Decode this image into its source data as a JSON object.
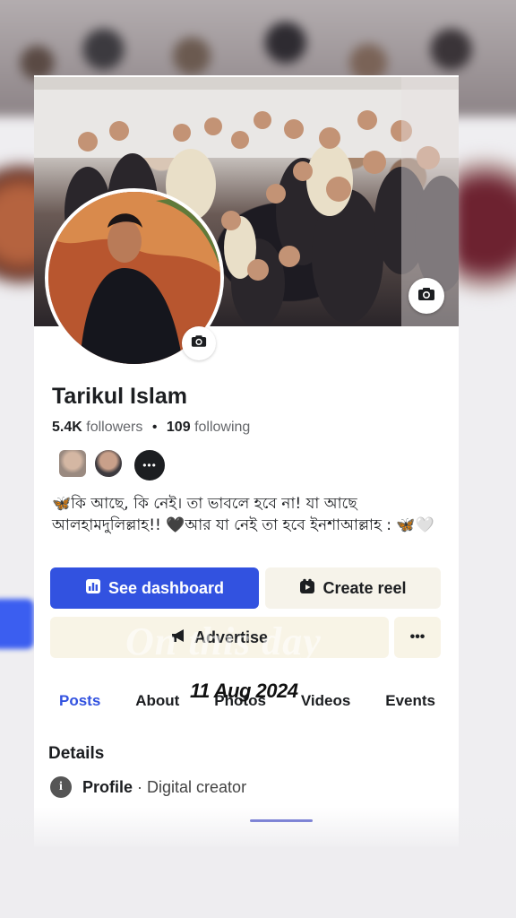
{
  "profile": {
    "name": "Tarikul Islam",
    "followers_count": "5.4K",
    "followers_label": "followers",
    "separator": "•",
    "following_count": "109",
    "following_label": "following",
    "more_friends_glyph": "•••",
    "bio": "🦋কি আছে, কি নেই। তা ভাবলে হবে না! যা আছে আলহামদুলিল্লাহ!! 🖤আর যা নেই তা হবে ইনশাআল্লাহ : 🦋🤍"
  },
  "actions": {
    "dashboard_label": "See dashboard",
    "reel_label": "Create reel",
    "advertise_label": "Advertise",
    "more_label": "•••"
  },
  "overlay": {
    "watermark": "On this day",
    "date": "11 Aug 2024"
  },
  "tabs": [
    {
      "label": "Posts",
      "active": true
    },
    {
      "label": "About"
    },
    {
      "label": "Photos"
    },
    {
      "label": "Videos"
    },
    {
      "label": "Events"
    }
  ],
  "details": {
    "title": "Details",
    "profile_label": "Profile",
    "profile_sep": " · ",
    "profile_value": "Digital creator"
  },
  "icons": {
    "cover_camera": "camera-icon",
    "avatar_camera": "camera-icon",
    "dashboard": "bar-chart-icon",
    "reel": "reel-icon",
    "advertise": "megaphone-icon",
    "info": "info-icon"
  },
  "colors": {
    "accent": "#3252e0",
    "text": "#1c1e21",
    "muted": "#65676b"
  }
}
